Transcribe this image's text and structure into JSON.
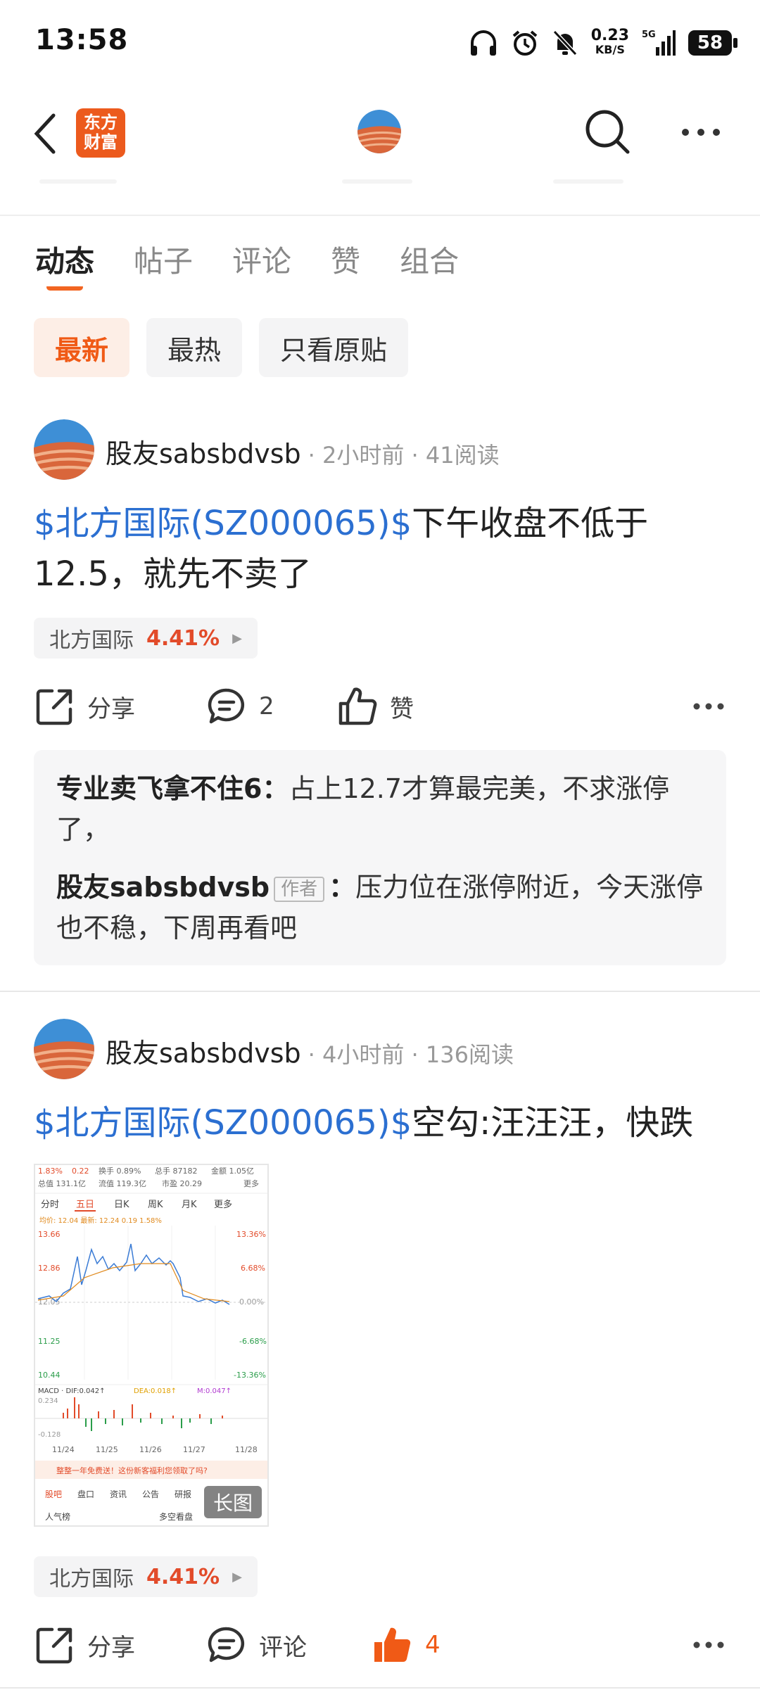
{
  "status_bar": {
    "time": "13:58",
    "speed": "0.23",
    "speed_unit": "KB/S",
    "network": "5G",
    "battery": "58"
  },
  "nav": {
    "logo_text": "东方财富",
    "icons": [
      "back-icon",
      "search-icon",
      "more-icon"
    ]
  },
  "tabs": [
    "动态",
    "帖子",
    "评论",
    "赞",
    "组合"
  ],
  "filters": [
    "最新",
    "最热",
    "只看原贴"
  ],
  "colors": {
    "accent": "#f26522",
    "link": "#2b6fd1",
    "up": "#e24b2a"
  },
  "posts": [
    {
      "author": "股友sabsbdvsb",
      "meta": "· 2小时前 · 41阅读",
      "stock_link": "$北方国际(SZ000065)$",
      "text": "下午收盘不低于12.5，就先不卖了",
      "stock_name": "北方国际",
      "stock_change": "4.41%",
      "share_label": "分享",
      "comment_label": "2",
      "like_label": "赞",
      "comments": [
        {
          "name": "专业卖飞拿不住6：",
          "text": "占上12.7才算最完美，不求涨停了，"
        },
        {
          "name": "股友sabsbdvsb",
          "tag": "作者",
          "colon": "：",
          "text": "压力位在涨停附近，今天涨停也不稳，下周再看吧"
        }
      ]
    },
    {
      "author": "股友sabsbdvsb",
      "meta": "· 4小时前 · 136阅读",
      "stock_link": "$北方国际(SZ000065)$",
      "text": "空勾:汪汪汪，快跌",
      "stock_name": "北方国际",
      "stock_change": "4.41%",
      "share_label": "分享",
      "comment_label": "评论",
      "like_label": "4",
      "image_badge": "长图",
      "thumb": {
        "top_row": [
          "1.83%",
          "0.22",
          "换手 0.89%",
          "总手 87182",
          "金额 1.05亿"
        ],
        "info_row": [
          "总值 131.1亿",
          "流值 119.3亿",
          "市盈 20.29",
          "更多"
        ],
        "periods": [
          "分时",
          "五日",
          "日K",
          "周K",
          "月K",
          "更多"
        ],
        "avg_line": "均价: 12.04  最新: 12.24  0.19  1.58%",
        "y_left": [
          "13.66",
          "12.86",
          "12.05",
          "11.25",
          "10.44"
        ],
        "y_right": [
          "13.36%",
          "6.68%",
          "0.00%",
          "-6.68%",
          "-13.36%"
        ],
        "macd": [
          "MACD · DIF:0.042↑",
          "DEA:0.018↑",
          "M:0.047↑"
        ],
        "macd_y": [
          "0.234",
          "-0.128"
        ],
        "dates": [
          "11/24",
          "11/25",
          "11/26",
          "11/27",
          "11/28"
        ],
        "banner": "整整一年免费送！这份新客福利您领取了吗?",
        "bottom_tabs": [
          "股吧",
          "盘口",
          "资讯",
          "公告",
          "研报"
        ],
        "bottom_row": [
          "人气榜",
          "多空看盘"
        ]
      }
    }
  ]
}
